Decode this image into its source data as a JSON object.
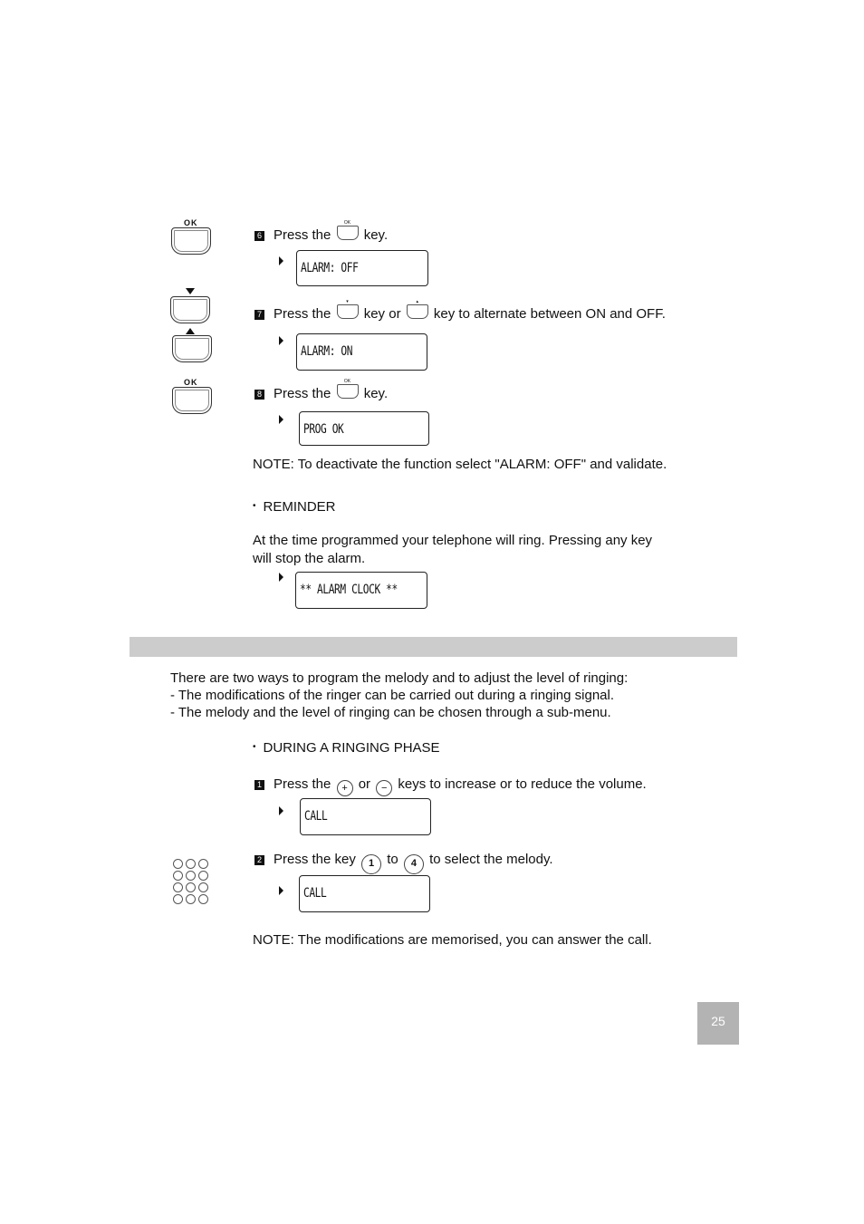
{
  "alarm_section": {
    "steps": [
      {
        "num": "6",
        "pre": "Press the",
        "key1_icon": "ok-key-icon",
        "key1_mini": "OK",
        "post": "key.",
        "display": "ALARM: OFF"
      },
      {
        "num": "7",
        "pre": "Press the",
        "key1_icon": "down-key-icon",
        "mid": "key or",
        "key2_icon": "up-key-icon",
        "post": "key to alternate between ON and OFF.",
        "display": "ALARM: ON"
      },
      {
        "num": "8",
        "pre": "Press the",
        "key1_icon": "ok-key-icon",
        "key1_mini": "OK",
        "post": "key.",
        "display": "PROG OK"
      }
    ],
    "side_keys": {
      "ok_label": "OK"
    },
    "note": "NOTE: To deactivate the function select \"ALARM: OFF\" and validate.",
    "reminder": {
      "bullet": "•",
      "heading": "REMINDER",
      "text_line1": "At the time programmed your telephone will ring. Pressing any key",
      "text_line2": "will stop the alarm.",
      "display": "** ALARM CLOCK **"
    }
  },
  "ringer_section": {
    "section_bar_title": "",
    "intro": [
      "There are two ways to program the melody and to adjust the level of ringing:",
      "- The modifications of the ringer can be carried out during a ringing signal.",
      "- The melody and the level of ringing can be chosen through a sub-menu."
    ],
    "subheading": {
      "bullet": "•",
      "text": "DURING A RINGING PHASE"
    },
    "steps": [
      {
        "num": "1",
        "pre": "Press the",
        "key1": "+",
        "mid": "or",
        "key2": "−",
        "post": "keys to increase or to reduce the volume.",
        "display": "CALL"
      },
      {
        "num": "2",
        "pre": "Press the key",
        "key1": "1",
        "mid": "to",
        "key2": "4",
        "post": "to select the melody.",
        "display": "CALL"
      }
    ],
    "note": "NOTE: The modifications are memorised, you can answer the call."
  },
  "page_number": "25"
}
